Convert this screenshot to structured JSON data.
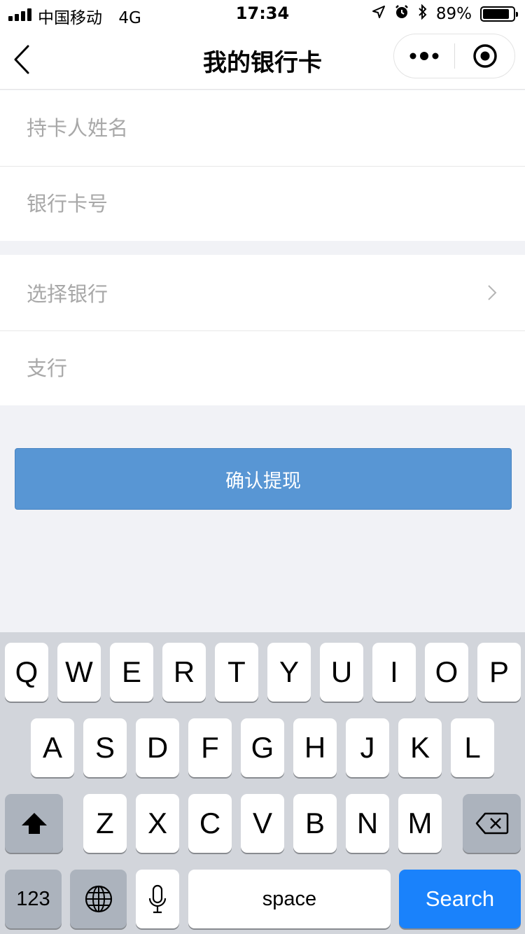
{
  "status_bar": {
    "carrier": "中国移动",
    "network": "4G",
    "time": "17:34",
    "battery_percent": "89%",
    "battery_level": 0.89,
    "icons": [
      "location-arrow-icon",
      "alarm-icon",
      "bluetooth-icon"
    ]
  },
  "nav": {
    "title": "我的银行卡",
    "back_icon": "chevron-left-icon",
    "more_icon": "more-dots-icon",
    "close_icon": "target-circle-icon"
  },
  "form": {
    "cardholder_placeholder": "持卡人姓名",
    "card_number_placeholder": "银行卡号",
    "select_bank_label": "选择银行",
    "branch_placeholder": "支行"
  },
  "confirm_label": "确认提现",
  "colors": {
    "button": "#5896d4",
    "search_key": "#1a82fb",
    "keyboard_bg": "#d2d5db",
    "page_bg": "#f1f2f6"
  },
  "keyboard": {
    "row1": [
      "Q",
      "W",
      "E",
      "R",
      "T",
      "Y",
      "U",
      "I",
      "O",
      "P"
    ],
    "row2": [
      "A",
      "S",
      "D",
      "F",
      "G",
      "H",
      "J",
      "K",
      "L"
    ],
    "row3": [
      "Z",
      "X",
      "C",
      "V",
      "B",
      "N",
      "M"
    ],
    "numbers_label": "123",
    "space_label": "space",
    "search_label": "Search"
  }
}
